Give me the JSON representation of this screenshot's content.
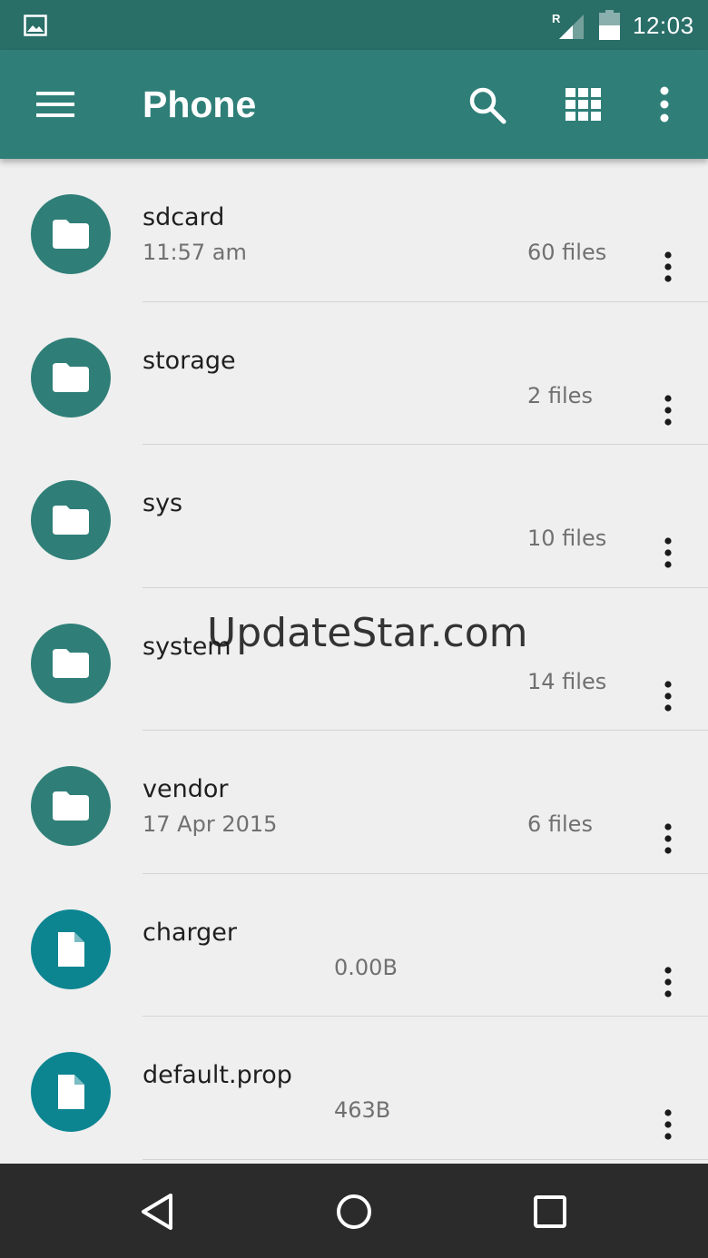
{
  "status_bar": {
    "time": "12:03",
    "roaming_indicator": "R",
    "icons": [
      "image-icon",
      "signal-icon",
      "battery-icon"
    ]
  },
  "toolbar": {
    "title": "Phone",
    "icons": [
      "menu-icon",
      "search-icon",
      "grid-view-icon",
      "more-vert-icon"
    ]
  },
  "files": [
    {
      "name": "sdcard",
      "date": "11:57 am",
      "count": "60 files",
      "size": "",
      "type": "folder"
    },
    {
      "name": "storage",
      "date": "",
      "count": "2 files",
      "size": "",
      "type": "folder"
    },
    {
      "name": "sys",
      "date": "",
      "count": "10 files",
      "size": "",
      "type": "folder"
    },
    {
      "name": "system",
      "date": "",
      "count": "14 files",
      "size": "",
      "type": "folder"
    },
    {
      "name": "vendor",
      "date": "17 Apr 2015",
      "count": "6 files",
      "size": "",
      "type": "folder"
    },
    {
      "name": "charger",
      "date": "",
      "count": "",
      "size": "0.00B",
      "type": "file"
    },
    {
      "name": "default.prop",
      "date": "",
      "count": "",
      "size": "463B",
      "type": "file"
    }
  ],
  "watermark": "UpdateStar.com",
  "nav_bar": {
    "icons": [
      "back-icon",
      "home-icon",
      "recents-icon"
    ]
  },
  "colors": {
    "status_bar": "#2a6e68",
    "toolbar": "#2f7f78",
    "folder_avatar": "#2f7f78",
    "file_avatar": "#0c8591",
    "background": "#efefef",
    "nav_bar": "#2b2b2b"
  }
}
